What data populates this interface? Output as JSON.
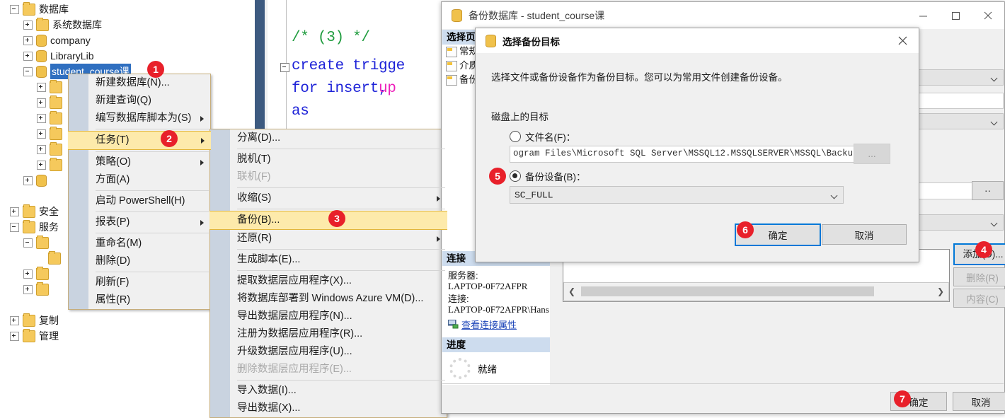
{
  "tree": {
    "nodes": [
      {
        "label": "数据库",
        "indent": 0,
        "icon": "folder-icon",
        "state": "minus",
        "selected": false
      },
      {
        "label": "系统数据库",
        "indent": 1,
        "icon": "folder-icon",
        "state": "plus",
        "selected": false
      },
      {
        "label": "company",
        "indent": 1,
        "icon": "database-icon",
        "state": "plus",
        "selected": false
      },
      {
        "label": "LibraryLib",
        "indent": 1,
        "icon": "database-icon",
        "state": "plus",
        "selected": false
      },
      {
        "label": "student_course课",
        "indent": 1,
        "icon": "database-icon",
        "state": "minus",
        "selected": true
      },
      {
        "label": "",
        "indent": 2,
        "icon": "folder-icon",
        "state": "plus",
        "selected": false
      },
      {
        "label": "",
        "indent": 2,
        "icon": "folder-icon",
        "state": "plus",
        "selected": false
      },
      {
        "label": "",
        "indent": 2,
        "icon": "folder-icon",
        "state": "plus",
        "selected": false
      },
      {
        "label": "",
        "indent": 2,
        "icon": "folder-icon",
        "state": "plus",
        "selected": false
      },
      {
        "label": "",
        "indent": 2,
        "icon": "folder-icon",
        "state": "plus",
        "selected": false
      },
      {
        "label": "",
        "indent": 2,
        "icon": "folder-icon",
        "state": "plus",
        "selected": false
      },
      {
        "label": "",
        "indent": 1,
        "icon": "database-icon",
        "state": "plus",
        "selected": false
      },
      {
        "label": "安全",
        "indent": 0,
        "icon": "folder-icon",
        "state": "plus",
        "selected": false
      },
      {
        "label": "服务",
        "indent": 0,
        "icon": "folder-icon",
        "state": "minus",
        "selected": false
      },
      {
        "label": "",
        "indent": 1,
        "icon": "folder-icon",
        "state": "minus",
        "selected": false
      },
      {
        "label": "",
        "indent": 2,
        "icon": "folder-icon",
        "state": "none",
        "selected": false
      },
      {
        "label": "",
        "indent": 1,
        "icon": "folder-icon",
        "state": "plus",
        "selected": false
      },
      {
        "label": "",
        "indent": 1,
        "icon": "folder-icon",
        "state": "plus",
        "selected": false
      },
      {
        "label": "复制",
        "indent": 0,
        "icon": "folder-icon",
        "state": "plus",
        "selected": false
      },
      {
        "label": "管理",
        "indent": 0,
        "icon": "folder-icon",
        "state": "plus",
        "selected": false
      }
    ]
  },
  "editor": {
    "lines": [
      {
        "text": "/* (3) */",
        "cls": "c-comment"
      },
      {
        "text": "create trigge",
        "cls": "c-kw"
      },
      {
        "text": "for insert,",
        "cls": "c-kw"
      },
      {
        "text": "up",
        "cls": "c-pink"
      },
      {
        "text": "as",
        "cls": "c-kw"
      }
    ]
  },
  "context_menu": {
    "items": [
      {
        "label": "新建数据库(N)...",
        "submenu": false,
        "disabled": false,
        "hot": false,
        "sep_after": false
      },
      {
        "label": "新建查询(Q)",
        "submenu": false,
        "disabled": false,
        "hot": false,
        "sep_after": false
      },
      {
        "label": "编写数据库脚本为(S)",
        "submenu": true,
        "disabled": false,
        "hot": false,
        "sep_after": true
      },
      {
        "label": "任务(T)",
        "submenu": true,
        "disabled": false,
        "hot": true,
        "sep_after": true
      },
      {
        "label": "策略(O)",
        "submenu": true,
        "disabled": false,
        "hot": false,
        "sep_after": false
      },
      {
        "label": "方面(A)",
        "submenu": false,
        "disabled": false,
        "hot": false,
        "sep_after": true
      },
      {
        "label": "启动 PowerShell(H)",
        "submenu": false,
        "disabled": false,
        "hot": false,
        "sep_after": true
      },
      {
        "label": "报表(P)",
        "submenu": true,
        "disabled": false,
        "hot": false,
        "sep_after": true
      },
      {
        "label": "重命名(M)",
        "submenu": false,
        "disabled": false,
        "hot": false,
        "sep_after": false
      },
      {
        "label": "删除(D)",
        "submenu": false,
        "disabled": false,
        "hot": false,
        "sep_after": true
      },
      {
        "label": "刷新(F)",
        "submenu": false,
        "disabled": false,
        "hot": false,
        "sep_after": false
      },
      {
        "label": "属性(R)",
        "submenu": false,
        "disabled": false,
        "hot": false,
        "sep_after": false
      }
    ]
  },
  "tasks_submenu": {
    "items": [
      {
        "label": "分离(D)...",
        "submenu": false,
        "disabled": false,
        "hot": false,
        "sep_after": true
      },
      {
        "label": "脱机(T)",
        "submenu": false,
        "disabled": false,
        "hot": false,
        "sep_after": false
      },
      {
        "label": "联机(F)",
        "submenu": false,
        "disabled": true,
        "hot": false,
        "sep_after": true
      },
      {
        "label": "收缩(S)",
        "submenu": true,
        "disabled": false,
        "hot": false,
        "sep_after": true
      },
      {
        "label": "备份(B)...",
        "submenu": false,
        "disabled": false,
        "hot": true,
        "sep_after": false
      },
      {
        "label": "还原(R)",
        "submenu": true,
        "disabled": false,
        "hot": false,
        "sep_after": true
      },
      {
        "label": "生成脚本(E)...",
        "submenu": false,
        "disabled": false,
        "hot": false,
        "sep_after": true
      },
      {
        "label": "提取数据层应用程序(X)...",
        "submenu": false,
        "disabled": false,
        "hot": false,
        "sep_after": false
      },
      {
        "label": "将数据库部署到 Windows Azure VM(D)...",
        "submenu": false,
        "disabled": false,
        "hot": false,
        "sep_after": false
      },
      {
        "label": "导出数据层应用程序(N)...",
        "submenu": false,
        "disabled": false,
        "hot": false,
        "sep_after": false
      },
      {
        "label": "注册为数据层应用程序(R)...",
        "submenu": false,
        "disabled": false,
        "hot": false,
        "sep_after": false
      },
      {
        "label": "升级数据层应用程序(U)...",
        "submenu": false,
        "disabled": false,
        "hot": false,
        "sep_after": false
      },
      {
        "label": "删除数据层应用程序(E)...",
        "submenu": false,
        "disabled": true,
        "hot": false,
        "sep_after": true
      },
      {
        "label": "导入数据(I)...",
        "submenu": false,
        "disabled": false,
        "hot": false,
        "sep_after": false
      },
      {
        "label": "导出数据(X)...",
        "submenu": false,
        "disabled": false,
        "hot": false,
        "sep_after": false
      }
    ]
  },
  "backup_window": {
    "title": "备份数据库 - student_course课",
    "icon": "database-icon",
    "minimize_label": "—",
    "maximize_label": "□",
    "close_label": "✕",
    "select_page_header": "选择页",
    "pages": [
      "常规",
      "介质选项",
      "备份选项"
    ],
    "connection_header": "连接",
    "server_label": "服务器:",
    "server_value": "LAPTOP-0F72AFPR",
    "connection_label": "连接:",
    "connection_value": "LAPTOP-0F72AFPR\\Hans",
    "view_conn_link": "查看连接属性",
    "progress_header": "进度",
    "progress_status": "就绪",
    "add_button": "添加(D)...",
    "remove_button": "删除(R)",
    "contents_button": "内容(C)",
    "ok_button": "确定",
    "cancel_button": "取消"
  },
  "choose_dest_dialog": {
    "title": "选择备份目标",
    "icon": "database-icon",
    "close_label": "✕",
    "description": "选择文件或备份设备作为备份目标。您可以为常用文件创建备份设备。",
    "group_label": "磁盘上的目标",
    "filename_radio_label": "文件名(F)：",
    "filename_value": "ogram Files\\Microsoft SQL Server\\MSSQL12.MSSQLSERVER\\MSSQL\\Backup\\",
    "filename_selected": false,
    "browse_button": "...",
    "device_radio_label": "备份设备(B)：",
    "device_value": "SC_FULL",
    "device_selected": true,
    "ok_button": "确定",
    "cancel_button": "取消"
  },
  "badges": [
    {
      "n": "1"
    },
    {
      "n": "2"
    },
    {
      "n": "3"
    },
    {
      "n": "4"
    },
    {
      "n": "5"
    },
    {
      "n": "6"
    },
    {
      "n": "7"
    }
  ],
  "colors": {
    "badge_red": "#e8202a",
    "menu_highlight": "#fdeaab",
    "selection_blue": "#2f6fc0",
    "focus_blue": "#0078d7",
    "panel_header": "#cddcee"
  }
}
